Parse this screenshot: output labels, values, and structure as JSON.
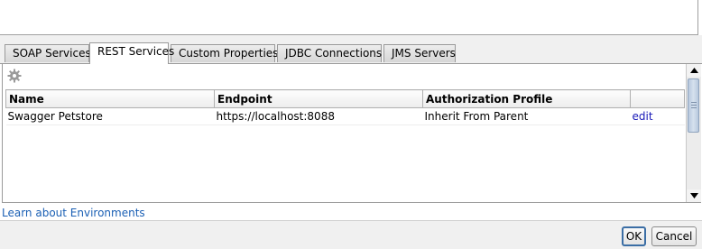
{
  "tabs": [
    {
      "label": "SOAP Services",
      "active": false
    },
    {
      "label": "REST Services",
      "active": true
    },
    {
      "label": "Custom Properties",
      "active": false
    },
    {
      "label": "JDBC Connections",
      "active": false
    },
    {
      "label": "JMS Servers",
      "active": false
    }
  ],
  "toolbar": {
    "icon": "gear-icon"
  },
  "table": {
    "columns": [
      "Name",
      "Endpoint",
      "Authorization Profile",
      ""
    ],
    "rows": [
      {
        "name": "Swagger Petstore",
        "endpoint": "https://localhost:8088",
        "auth": "Inherit From Parent",
        "action": "edit"
      }
    ]
  },
  "links": {
    "learn": "Learn about Environments"
  },
  "buttons": {
    "ok": "OK",
    "cancel": "Cancel"
  },
  "colors": {
    "link": "#1a5fb4",
    "edit_link": "#1a1ab8",
    "scroll_thumb": "#b7c8dd"
  }
}
